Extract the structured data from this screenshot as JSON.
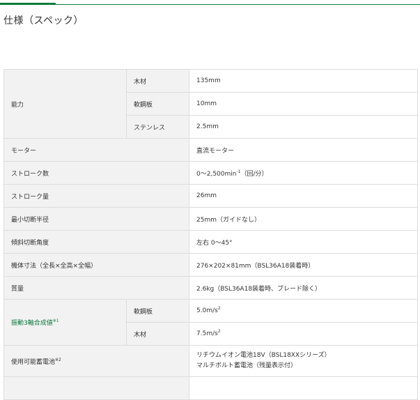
{
  "title": "仕様（スペック）",
  "rows": {
    "capacity": {
      "label": "能力",
      "wood": {
        "label": "木材",
        "value": "135mm"
      },
      "mild_steel": {
        "label": "軟鋼板",
        "value": "10mm"
      },
      "stainless": {
        "label": "ステンレス",
        "value": "2.5mm"
      }
    },
    "motor": {
      "label": "モーター",
      "value": "直流モーター"
    },
    "stroke_count": {
      "label": "ストローク数",
      "value_main": "0～2,500min",
      "value_sup": "-1",
      "value_unit": "（回/分）"
    },
    "stroke_length": {
      "label": "ストローク量",
      "value": "26mm"
    },
    "min_radius": {
      "label": "最小切断半径",
      "value": "25mm（ガイドなし）"
    },
    "bevel_angle": {
      "label": "傾斜切断角度",
      "value": "左右 0～45°"
    },
    "dimensions": {
      "label": "機体寸法（全長×全高×全幅）",
      "value": "276×202×81mm（BSL36A18装着時）"
    },
    "weight": {
      "label": "質量",
      "value": "2.6kg（BSL36A18装着時、ブレード除く）"
    },
    "vibration": {
      "label": "振動3軸合成値",
      "note": "※1",
      "mild_steel": {
        "label": "軟鋼板",
        "value": "5.0m/s",
        "sup": "2"
      },
      "wood": {
        "label": "木材",
        "value": "7.5m/s",
        "sup": "2"
      }
    },
    "battery": {
      "label": "使用可能蓄電池",
      "note": "※2",
      "line1": "リチウムイオン電池18V（BSL18XXシリーズ）",
      "line2": "マルチボルト蓄電池（残量表示付）"
    }
  },
  "colors": {
    "accent": "#0c7a3c",
    "header_bg": "#f2f2f2",
    "border": "#dcdcdc"
  }
}
